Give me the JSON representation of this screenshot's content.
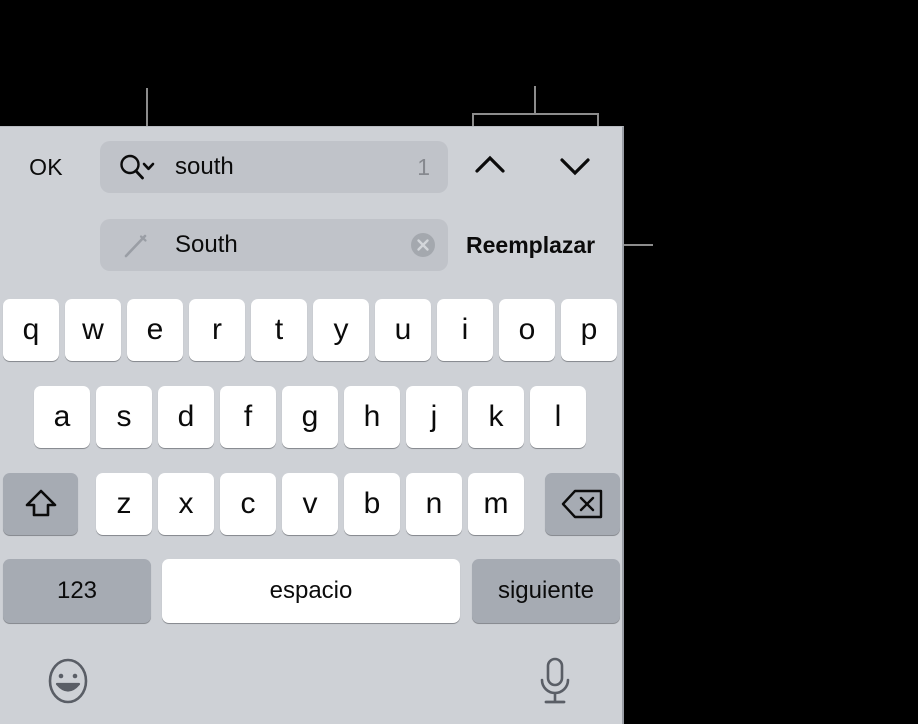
{
  "panel": {
    "background_color": "#ced1d6"
  },
  "find_bar": {
    "ok_label": "OK",
    "search_icon": "search-magnifier-with-chevron-icon",
    "search_value": "south",
    "match_count": "1",
    "prev_icon": "chevron-up-icon",
    "next_icon": "chevron-down-icon"
  },
  "replace_bar": {
    "pencil_icon": "pencil-edit-icon",
    "replace_value": "South",
    "clear_icon": "clear-circle-x-icon",
    "replace_label": "Reemplazar"
  },
  "keyboard": {
    "row1": [
      "q",
      "w",
      "e",
      "r",
      "t",
      "y",
      "u",
      "i",
      "o",
      "p"
    ],
    "row2": [
      "a",
      "s",
      "d",
      "f",
      "g",
      "h",
      "j",
      "k",
      "l"
    ],
    "row3": [
      "z",
      "x",
      "c",
      "v",
      "b",
      "n",
      "m"
    ],
    "shift_icon": "shift-arrow-up-icon",
    "delete_icon": "delete-backspace-icon",
    "numbers_label": "123",
    "space_label": "espacio",
    "next_label": "siguiente",
    "emoji_icon": "emoji-smiley-face-icon",
    "mic_icon": "microphone-icon"
  },
  "callouts": {
    "search_pointer": "callout-line-to-search-field",
    "nav_pointer": "callout-bracket-to-navigation-arrows",
    "replace_pointer": "callout-line-to-replace-button"
  }
}
